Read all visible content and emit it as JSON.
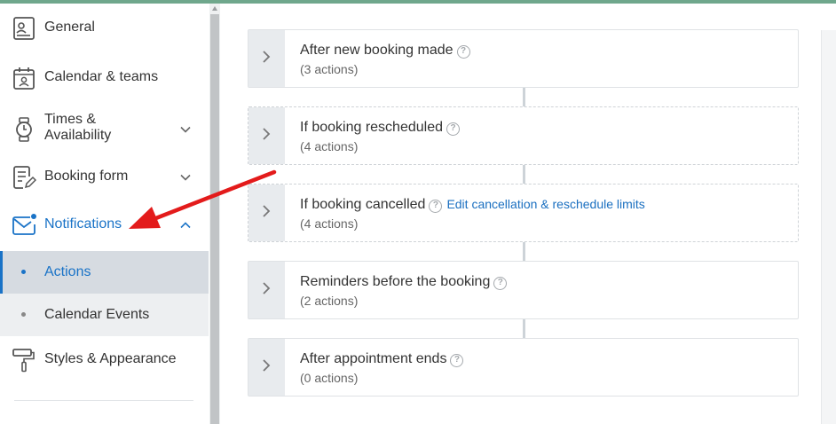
{
  "sidebar": {
    "items": [
      {
        "label": "General",
        "icon": "id-card-icon"
      },
      {
        "label": "Calendar & teams",
        "icon": "calendar-person-icon"
      },
      {
        "label_line1": "Times &",
        "label_line2": "Availability",
        "icon": "watch-icon"
      },
      {
        "label": "Booking form",
        "icon": "form-edit-icon"
      },
      {
        "label": "Notifications",
        "icon": "mail-icon"
      },
      {
        "label": "Styles & Appearance",
        "icon": "paint-roller-icon"
      }
    ],
    "sub_items": [
      {
        "label": "Actions",
        "active": true
      },
      {
        "label": "Calendar Events",
        "active": false
      }
    ]
  },
  "cards": [
    {
      "title": "After new booking made",
      "subtitle": "(3 actions)"
    },
    {
      "title": "If booking rescheduled",
      "subtitle": "(4 actions)"
    },
    {
      "title": "If booking cancelled",
      "subtitle": "(4 actions)",
      "link": "Edit cancellation & reschedule limits"
    },
    {
      "title": "Reminders before the booking",
      "subtitle": "(2 actions)"
    },
    {
      "title": "After appointment ends",
      "subtitle": "(0 actions)"
    }
  ],
  "help_glyph": "?",
  "colors": {
    "accent": "#1a73c7",
    "top_bar": "#6fa78c",
    "annotation_arrow": "#e31b1b",
    "active_sub_bg": "#d6dbe1"
  }
}
